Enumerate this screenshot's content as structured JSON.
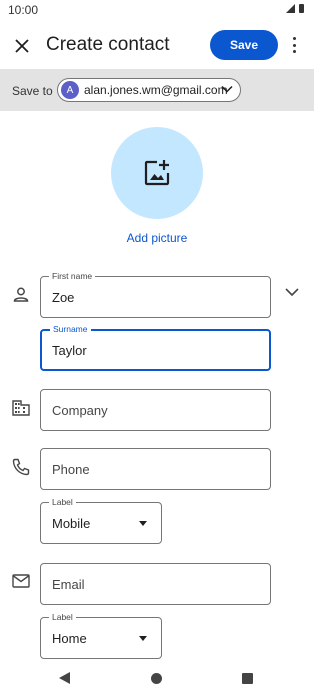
{
  "status": {
    "time": "10:00"
  },
  "header": {
    "title": "Create contact",
    "save_label": "Save"
  },
  "save_to": {
    "label": "Save to",
    "account_initial": "A",
    "account_email": "alan.jones.wm@gmail.com"
  },
  "photo": {
    "add_label": "Add picture"
  },
  "name": {
    "first_label": "First name",
    "first_value": "Zoe",
    "surname_label": "Surname",
    "surname_value": "Taylor"
  },
  "company": {
    "placeholder": "Company"
  },
  "phone": {
    "placeholder": "Phone",
    "label_legend": "Label",
    "label_value": "Mobile"
  },
  "email": {
    "placeholder": "Email",
    "label_legend": "Label",
    "label_value": "Home"
  },
  "colors": {
    "accent": "#0b57d0",
    "photo_bg": "#c2e7ff",
    "band": "#e3e3e3"
  }
}
